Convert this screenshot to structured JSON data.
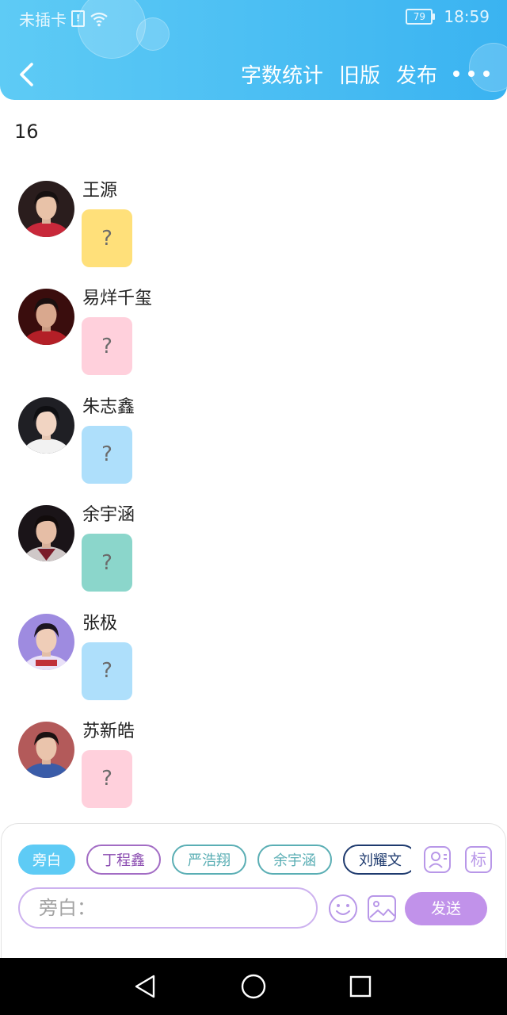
{
  "status_bar": {
    "carrier": "未插卡",
    "battery": "79",
    "time": "18:59"
  },
  "nav": {
    "actions": [
      "字数统计",
      "旧版",
      "发布"
    ]
  },
  "word_count": "16",
  "messages": [
    {
      "name": "王源",
      "content": "?",
      "bubble_color": "#ffe07a",
      "avatar_bg": "#2a1d1d",
      "avatar_accent": "#c8283a"
    },
    {
      "name": "易烊千玺",
      "content": "?",
      "bubble_color": "#ffd0dc",
      "avatar_bg": "#3a0d0d",
      "avatar_accent": "#b31f27"
    },
    {
      "name": "朱志鑫",
      "content": "?",
      "bubble_color": "#aedffb",
      "avatar_bg": "#1f1f24",
      "avatar_accent": "#f2f2f2"
    },
    {
      "name": "余宇涵",
      "content": "?",
      "bubble_color": "#8bd6cb",
      "avatar_bg": "#1a1418",
      "avatar_accent": "#cfc8c8"
    },
    {
      "name": "张极",
      "content": "?",
      "bubble_color": "#aedffb",
      "avatar_bg": "#9e8be0",
      "avatar_accent": "#e9e1f8"
    },
    {
      "name": "苏新皓",
      "content": "?",
      "bubble_color": "#ffd0dc",
      "avatar_bg": "#b35a5a",
      "avatar_accent": "#3a5ca8"
    }
  ],
  "input_panel": {
    "roles": [
      {
        "label": "旁白",
        "color": "#5ecbf5",
        "active": true
      },
      {
        "label": "丁程鑫",
        "color": "#a26cc4",
        "active": false
      },
      {
        "label": "严浩翔",
        "color": "#5aaeb4",
        "active": false
      },
      {
        "label": "余宇涵",
        "color": "#5aaeb4",
        "active": false
      },
      {
        "label": "刘耀文",
        "color": "#1e3a6e",
        "active": false
      }
    ],
    "tag_label": "标",
    "placeholder": "旁白：",
    "send_label": "发送"
  },
  "icons": {
    "back": "chevron-left-icon",
    "more": "more-dots-icon",
    "contact": "contact-card-icon",
    "emoji": "smile-icon",
    "image": "image-icon"
  }
}
